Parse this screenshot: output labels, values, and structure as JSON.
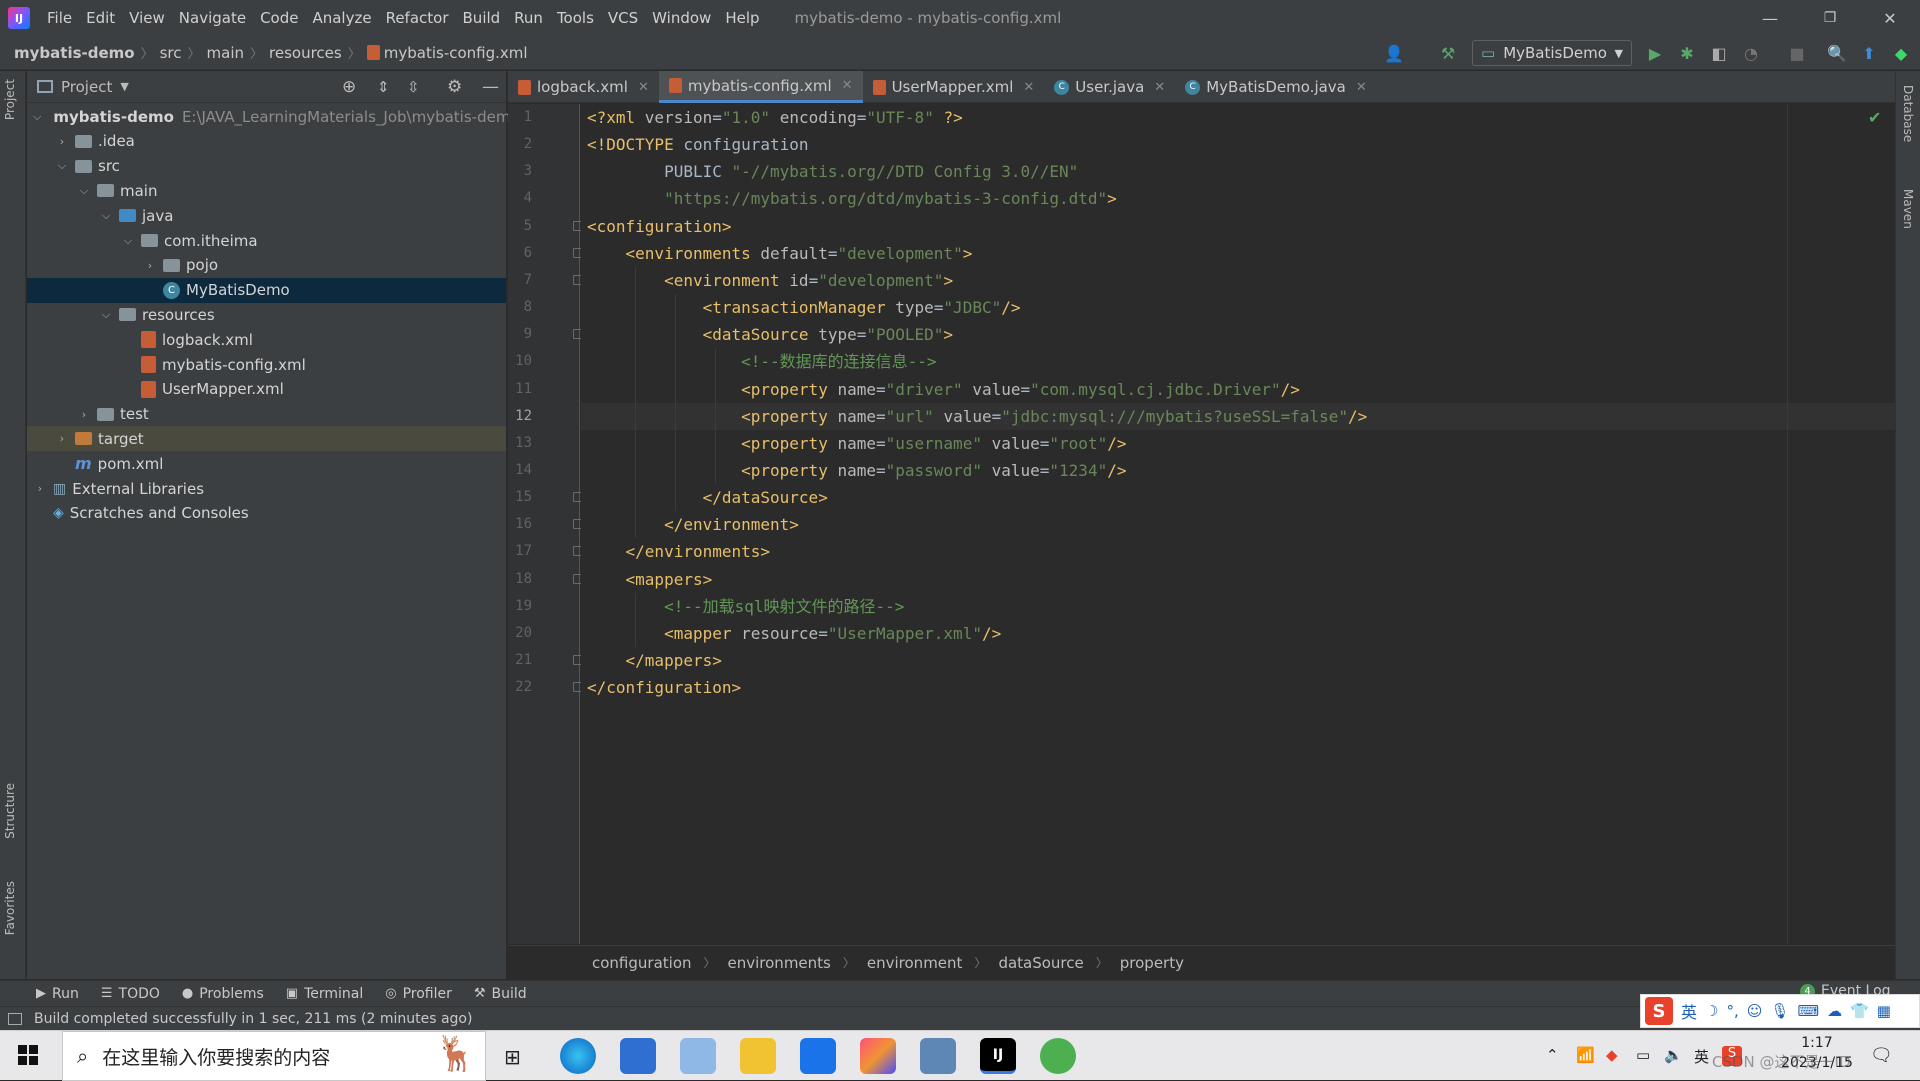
{
  "titlebar": {
    "menu": [
      "File",
      "Edit",
      "View",
      "Navigate",
      "Code",
      "Analyze",
      "Refactor",
      "Build",
      "Run",
      "Tools",
      "VCS",
      "Window",
      "Help"
    ],
    "window_title": "mybatis-demo - mybatis-config.xml",
    "minimize_glyph": "—",
    "restore_glyph": "❐",
    "close_glyph": "✕"
  },
  "navbar": {
    "crumbs": [
      "mybatis-demo",
      "src",
      "main",
      "resources",
      "mybatis-config.xml"
    ],
    "run_config": "MyBatisDemo"
  },
  "sidebar_tabs": {
    "left": [
      "Project",
      "Structure",
      "Favorites"
    ],
    "right": [
      "Database",
      "Maven"
    ]
  },
  "project_panel": {
    "title": "Project",
    "tree": [
      {
        "label": "mybatis-demo",
        "extra": "E:\\JAVA_LearningMaterials_Job\\mybatis-demo",
        "depth": 0,
        "icon": "folder",
        "expanded": true,
        "bold": true
      },
      {
        "label": ".idea",
        "depth": 1,
        "icon": "folder",
        "expanded": false
      },
      {
        "label": "src",
        "depth": 1,
        "icon": "folder",
        "expanded": true
      },
      {
        "label": "main",
        "depth": 2,
        "icon": "folder",
        "expanded": true
      },
      {
        "label": "java",
        "depth": 3,
        "icon": "folder-blue",
        "expanded": true
      },
      {
        "label": "com.itheima",
        "depth": 4,
        "icon": "package",
        "expanded": true
      },
      {
        "label": "pojo",
        "depth": 5,
        "icon": "package",
        "expanded": false
      },
      {
        "label": "MyBatisDemo",
        "depth": 5,
        "icon": "class",
        "selected": true
      },
      {
        "label": "resources",
        "depth": 3,
        "icon": "folder-res",
        "expanded": true
      },
      {
        "label": "logback.xml",
        "depth": 4,
        "icon": "xml"
      },
      {
        "label": "mybatis-config.xml",
        "depth": 4,
        "icon": "xml"
      },
      {
        "label": "UserMapper.xml",
        "depth": 4,
        "icon": "xml"
      },
      {
        "label": "test",
        "depth": 2,
        "icon": "folder",
        "expanded": false
      },
      {
        "label": "target",
        "depth": 1,
        "icon": "folder-orange",
        "expanded": false,
        "excluded": true
      },
      {
        "label": "pom.xml",
        "depth": 1,
        "icon": "maven"
      },
      {
        "label": "External Libraries",
        "depth": 0,
        "icon": "library",
        "expanded": false
      },
      {
        "label": "Scratches and Consoles",
        "depth": 0,
        "icon": "scratch"
      }
    ]
  },
  "editor_tabs": [
    {
      "label": "logback.xml",
      "icon": "xml",
      "active": false
    },
    {
      "label": "mybatis-config.xml",
      "icon": "xml",
      "active": true
    },
    {
      "label": "UserMapper.xml",
      "icon": "xml",
      "active": false
    },
    {
      "label": "User.java",
      "icon": "class",
      "active": false
    },
    {
      "label": "MyBatisDemo.java",
      "icon": "class",
      "active": false
    }
  ],
  "editor": {
    "current_line": 12,
    "lines": [
      [
        [
          "pi",
          "<?xml "
        ],
        [
          "attr",
          "version"
        ],
        [
          "plain",
          "="
        ],
        [
          "val",
          "\"1.0\""
        ],
        [
          "plain",
          " "
        ],
        [
          "attr",
          "encoding"
        ],
        [
          "plain",
          "="
        ],
        [
          "val",
          "\"UTF-8\""
        ],
        [
          "pi",
          " ?>"
        ]
      ],
      [
        [
          "doc",
          "<!DOCTYPE "
        ],
        [
          "plain",
          "configuration"
        ]
      ],
      [
        [
          "plain",
          "        PUBLIC "
        ],
        [
          "val",
          "\"-//mybatis.org//DTD Config 3.0//EN\""
        ]
      ],
      [
        [
          "plain",
          "        "
        ],
        [
          "val",
          "\"https://mybatis.org/dtd/mybatis-3-config.dtd\""
        ],
        [
          "doc",
          ">"
        ]
      ],
      [
        [
          "tag",
          "<configuration>"
        ]
      ],
      [
        [
          "plain",
          "    "
        ],
        [
          "tag",
          "<environments "
        ],
        [
          "attr",
          "default"
        ],
        [
          "plain",
          "="
        ],
        [
          "val",
          "\"development\""
        ],
        [
          "tag",
          ">"
        ]
      ],
      [
        [
          "plain",
          "        "
        ],
        [
          "tag",
          "<environment "
        ],
        [
          "attr",
          "id"
        ],
        [
          "plain",
          "="
        ],
        [
          "val",
          "\"development\""
        ],
        [
          "tag",
          ">"
        ]
      ],
      [
        [
          "plain",
          "            "
        ],
        [
          "tag",
          "<transactionManager "
        ],
        [
          "attr",
          "type"
        ],
        [
          "plain",
          "="
        ],
        [
          "val",
          "\"JDBC\""
        ],
        [
          "tag",
          "/>"
        ]
      ],
      [
        [
          "plain",
          "            "
        ],
        [
          "tag",
          "<dataSource "
        ],
        [
          "attr",
          "type"
        ],
        [
          "plain",
          "="
        ],
        [
          "val",
          "\"POOLED\""
        ],
        [
          "tag",
          ">"
        ]
      ],
      [
        [
          "plain",
          "                "
        ],
        [
          "cmt",
          "<!--数据库的连接信息-->"
        ]
      ],
      [
        [
          "plain",
          "                "
        ],
        [
          "tag",
          "<property "
        ],
        [
          "attr",
          "name"
        ],
        [
          "plain",
          "="
        ],
        [
          "val",
          "\"driver\""
        ],
        [
          "plain",
          " "
        ],
        [
          "attr",
          "value"
        ],
        [
          "plain",
          "="
        ],
        [
          "val",
          "\"com.mysql.cj.jdbc.Driver\""
        ],
        [
          "tag",
          "/>"
        ]
      ],
      [
        [
          "plain",
          "                "
        ],
        [
          "tag",
          "<property "
        ],
        [
          "attr",
          "name"
        ],
        [
          "plain",
          "="
        ],
        [
          "val",
          "\"url\""
        ],
        [
          "plain",
          " "
        ],
        [
          "attr",
          "value"
        ],
        [
          "plain",
          "="
        ],
        [
          "val",
          "\"jdbc:mysql:///mybatis?useSSL=false\""
        ],
        [
          "tag",
          "/>"
        ]
      ],
      [
        [
          "plain",
          "                "
        ],
        [
          "tag",
          "<property "
        ],
        [
          "attr",
          "name"
        ],
        [
          "plain",
          "="
        ],
        [
          "val",
          "\"username\""
        ],
        [
          "plain",
          " "
        ],
        [
          "attr",
          "value"
        ],
        [
          "plain",
          "="
        ],
        [
          "val",
          "\"root\""
        ],
        [
          "tag",
          "/>"
        ]
      ],
      [
        [
          "plain",
          "                "
        ],
        [
          "tag",
          "<property "
        ],
        [
          "attr",
          "name"
        ],
        [
          "plain",
          "="
        ],
        [
          "val",
          "\"password\""
        ],
        [
          "plain",
          " "
        ],
        [
          "attr",
          "value"
        ],
        [
          "plain",
          "="
        ],
        [
          "val",
          "\"1234\""
        ],
        [
          "tag",
          "/>"
        ]
      ],
      [
        [
          "plain",
          "            "
        ],
        [
          "tag",
          "</dataSource>"
        ]
      ],
      [
        [
          "plain",
          "        "
        ],
        [
          "tag",
          "</environment>"
        ]
      ],
      [
        [
          "plain",
          "    "
        ],
        [
          "tag",
          "</environments>"
        ]
      ],
      [
        [
          "plain",
          "    "
        ],
        [
          "tag",
          "<mappers>"
        ]
      ],
      [
        [
          "plain",
          "        "
        ],
        [
          "cmt",
          "<!--加载sql映射文件的路径-->"
        ]
      ],
      [
        [
          "plain",
          "        "
        ],
        [
          "tag",
          "<mapper "
        ],
        [
          "attr",
          "resource"
        ],
        [
          "plain",
          "="
        ],
        [
          "val",
          "\"UserMapper.xml\""
        ],
        [
          "tag",
          "/>"
        ]
      ],
      [
        [
          "plain",
          "    "
        ],
        [
          "tag",
          "</mappers>"
        ]
      ],
      [
        [
          "tag",
          "</configuration>"
        ]
      ]
    ],
    "fold_lines": [
      5,
      6,
      7,
      9,
      15,
      16,
      17,
      18,
      21,
      22
    ]
  },
  "xml_breadcrumb": [
    "configuration",
    "environments",
    "environment",
    "dataSource",
    "property"
  ],
  "tool_windows": [
    {
      "icon": "play-icon",
      "label": "Run"
    },
    {
      "icon": "todo-icon",
      "label": "TODO"
    },
    {
      "icon": "problems-icon",
      "label": "Problems"
    },
    {
      "icon": "terminal-icon",
      "label": "Terminal"
    },
    {
      "icon": "profiler-icon",
      "label": "Profiler"
    },
    {
      "icon": "hammer-icon",
      "label": "Build"
    }
  ],
  "event_log": {
    "count": "4",
    "label": "Event Log"
  },
  "status": {
    "message": "Build completed successfully in 1 sec, 211 ms (2 minutes ago)"
  },
  "ime_bar": {
    "lang": "英"
  },
  "taskbar": {
    "search_placeholder": "在这里输入你要搜索的内容",
    "ime_indicator": "英",
    "time": "1:17",
    "date": "2023/1/15",
    "watermark": "CSDN @这不是一ID"
  },
  "colors": {
    "tag": "#e8bf6a",
    "attr": "#bababa",
    "value": "#6a8759",
    "comment": "#629755",
    "accent": "#4a88c7",
    "selection": "#0d293e"
  }
}
